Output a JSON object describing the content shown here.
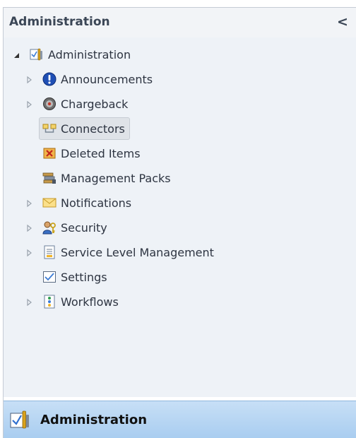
{
  "pane": {
    "title": "Administration",
    "collapse_glyph": "<"
  },
  "tree": {
    "root": {
      "label": "Administration",
      "icon": "administration-icon",
      "expander": "expanded"
    },
    "items": [
      {
        "label": "Announcements",
        "icon": "announcement-icon",
        "expander": "collapsed"
      },
      {
        "label": "Chargeback",
        "icon": "chargeback-icon",
        "expander": "collapsed"
      },
      {
        "label": "Connectors",
        "icon": "connectors-icon",
        "expander": "none",
        "selected": true
      },
      {
        "label": "Deleted Items",
        "icon": "deleted-items-icon",
        "expander": "none"
      },
      {
        "label": "Management Packs",
        "icon": "management-packs-icon",
        "expander": "none"
      },
      {
        "label": "Notifications",
        "icon": "notifications-icon",
        "expander": "collapsed"
      },
      {
        "label": "Security",
        "icon": "security-icon",
        "expander": "collapsed"
      },
      {
        "label": "Service Level Management",
        "icon": "service-level-icon",
        "expander": "collapsed"
      },
      {
        "label": "Settings",
        "icon": "settings-icon",
        "expander": "none"
      },
      {
        "label": "Workflows",
        "icon": "workflows-icon",
        "expander": "collapsed"
      }
    ]
  },
  "splitter": {
    "glyph": "·········"
  },
  "footer": {
    "label": "Administration",
    "icon": "administration-icon"
  },
  "colors": {
    "header_bg": "#f2f4f7",
    "tree_bg": "#eef2f7",
    "selected_bg": "#dfe3e8",
    "footer_bg": "#b8d6f3",
    "text": "#2d3441"
  }
}
